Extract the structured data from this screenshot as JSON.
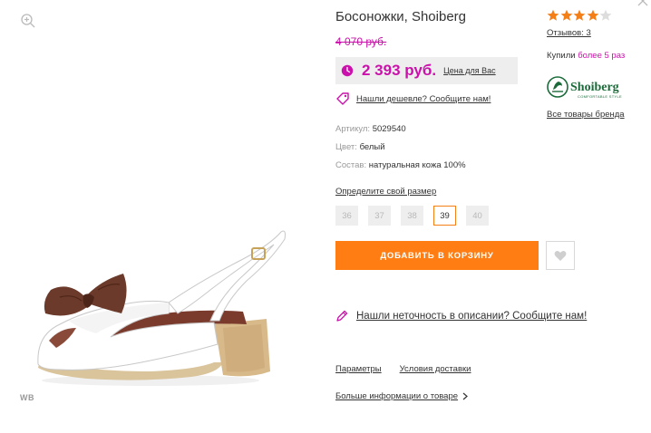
{
  "product": {
    "title": "Босоножки, Shoiberg",
    "old_price": "4 070 руб.",
    "new_price": "2 393 руб.",
    "price_for_you": "Цена для Вас",
    "found_cheaper": "Нашли дешевле? Сообщите нам!",
    "image_mark": "WB"
  },
  "params": [
    {
      "label": "Артикул:",
      "value": "5029540"
    },
    {
      "label": "Цвет:",
      "value": "белый"
    },
    {
      "label": "Состав:",
      "value": "натуральная кожа 100%"
    }
  ],
  "sizes": {
    "label": "Определите свой размер",
    "options": [
      "36",
      "37",
      "38",
      "39",
      "40"
    ],
    "selected": "39"
  },
  "actions": {
    "add_to_cart": "ДОБАВИТЬ В КОРЗИНУ",
    "report_error": "Нашли неточность в описании? Сообщите нам!"
  },
  "tabs": [
    "Параметры",
    "Условия доставки"
  ],
  "more_info": "Больше информации о товаре",
  "rating": {
    "stars": 4,
    "max": 5,
    "reviews": "Отзывов: 3",
    "bought_prefix": "Купили",
    "bought_value": "более 5 раз"
  },
  "brand": {
    "name": "Shoiberg",
    "tagline": "COMFORTABLE STYLE",
    "all_products": "Все товары бренда"
  },
  "colors": {
    "accent_pink": "#cb11ab",
    "button_orange": "#ff7d12",
    "star_orange": "#f57f17",
    "brand_green": "#1b6b3a"
  },
  "icons": {
    "zoom": "zoom-in-icon",
    "clock": "clock-icon",
    "tag": "tag-icon",
    "heart": "heart-icon",
    "pencil": "pencil-icon",
    "chevron": "chevron-right-icon",
    "close": "close-icon",
    "star": "star-icon"
  }
}
